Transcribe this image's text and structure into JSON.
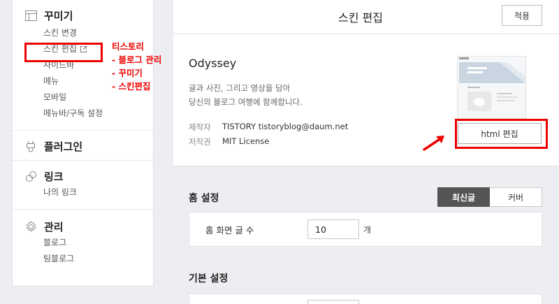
{
  "sidebar": {
    "decorate": {
      "title": "꾸미기",
      "items": [
        "스킨 변경",
        "스킨 편집",
        "사이드바",
        "메뉴",
        "모바일",
        "메뉴바/구독 설정"
      ]
    },
    "plugin": {
      "title": "플러그인"
    },
    "link": {
      "title": "링크",
      "items": [
        "나의 링크"
      ]
    },
    "manage": {
      "title": "관리",
      "items": [
        "블로그",
        "팀블로그"
      ]
    }
  },
  "annotation": [
    "티스토리",
    "- 블로그 관리",
    "- 꾸미기",
    "- 스킨편집"
  ],
  "header": {
    "title": "스킨 편집",
    "apply_label": "적용"
  },
  "skin": {
    "name": "Odyssey",
    "desc_line1": "글과 사진, 그리고 영상을 담아",
    "desc_line2": "당신의 블로그 여행에 함께합니다.",
    "author_key": "제작자",
    "author_val": "TISTORY tistoryblog@daum.net",
    "license_key": "저작권",
    "license_val": "MIT License",
    "edit_html_label": "html 편집"
  },
  "home_settings": {
    "title": "홈 설정",
    "tabs": [
      {
        "label": "최신글",
        "active": true
      },
      {
        "label": "커버",
        "active": false
      }
    ],
    "post_count_label": "홈 화면 글 수",
    "post_count_value": "10",
    "post_count_unit": "개"
  },
  "basic_settings": {
    "title": "기본 설정"
  },
  "colors": {
    "highlight": "#ee0000",
    "active_tab": "#555555",
    "background": "#eceef1"
  }
}
